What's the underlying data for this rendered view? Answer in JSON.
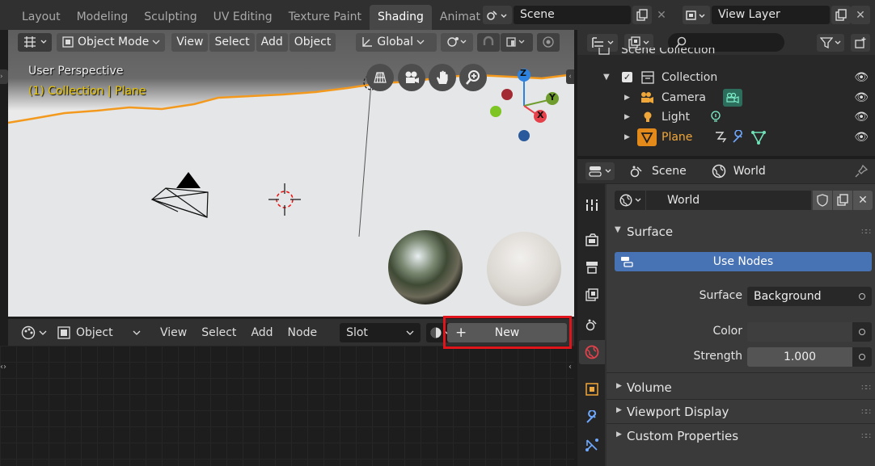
{
  "workspace_tabs": [
    "Layout",
    "Modeling",
    "Sculpting",
    "UV Editing",
    "Texture Paint",
    "Shading",
    "Animat"
  ],
  "active_tab": "Shading",
  "scene_selector": "Scene",
  "view_layer": "View Layer",
  "viewport": {
    "mode": "Object Mode",
    "menus": [
      "View",
      "Select",
      "Add",
      "Object"
    ],
    "transform_orientation": "Global",
    "perspective_label": "User Perspective",
    "collection_label": "(1) Collection | Plane",
    "gizmo_axes": [
      "Z",
      "Y",
      "X"
    ]
  },
  "node_editor": {
    "mode": "Object",
    "menus": [
      "View",
      "Select",
      "Add",
      "Node"
    ],
    "slot": "Slot",
    "new_button": "New",
    "new_icon": "+"
  },
  "outliner": {
    "search_placeholder": "",
    "items": [
      {
        "label": "Scene Collection",
        "icon": "scene-collection-icon"
      },
      {
        "label": "Collection",
        "icon": "collection-icon"
      },
      {
        "label": "Camera",
        "icon": "camera-icon"
      },
      {
        "label": "Light",
        "icon": "light-icon"
      },
      {
        "label": "Plane",
        "icon": "mesh-icon"
      }
    ]
  },
  "properties": {
    "breadcrumb_scene": "Scene",
    "breadcrumb_world": "World",
    "world_name": "World",
    "surface_panel": "Surface",
    "use_nodes_button": "Use Nodes",
    "surface_label": "Surface",
    "surface_value": "Background",
    "color_label": "Color",
    "strength_label": "Strength",
    "strength_value": "1.000",
    "collapsed_panels": [
      "Volume",
      "Viewport Display",
      "Custom Properties"
    ]
  },
  "colors": {
    "accent_blue": "#4772b3",
    "active_object_orange": "#f2a73a",
    "selection_highlight_red": "#e0141b",
    "axis_x": "#e6414a",
    "axis_y": "#6e9d2e",
    "axis_z": "#2f83e0"
  }
}
